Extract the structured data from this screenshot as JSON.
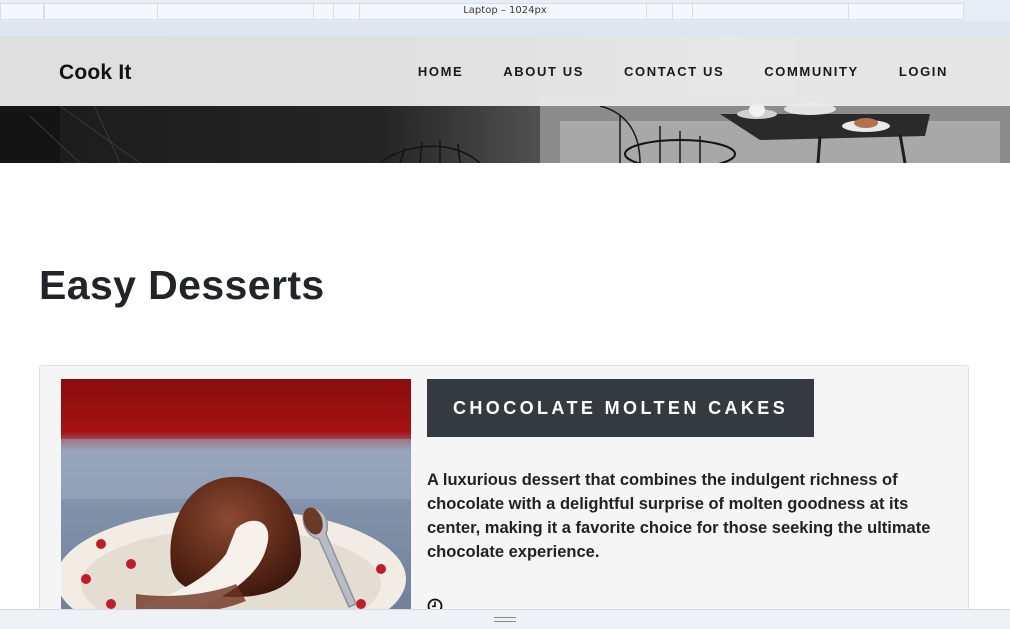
{
  "ruler": {
    "label": "Laptop – 1024px"
  },
  "header": {
    "brand": "Cook It",
    "nav": [
      "HOME",
      "ABOUT US",
      "CONTACT US",
      "COMMUNITY",
      "LOGIN"
    ]
  },
  "main": {
    "title": "Easy Desserts",
    "recipe": {
      "title": "CHOCOLATE MOLTEN CAKES",
      "description": "A luxurious dessert that combines the indulgent richness of chocolate with a delightful surprise of molten goodness at its center, making it a favorite choice for those seeking the ultimate chocolate experience.",
      "icon": "clock-icon"
    }
  },
  "colors": {
    "title_bg": "#343a40",
    "card_bg": "#f5f5f5",
    "nav_bg": "#ececec"
  }
}
